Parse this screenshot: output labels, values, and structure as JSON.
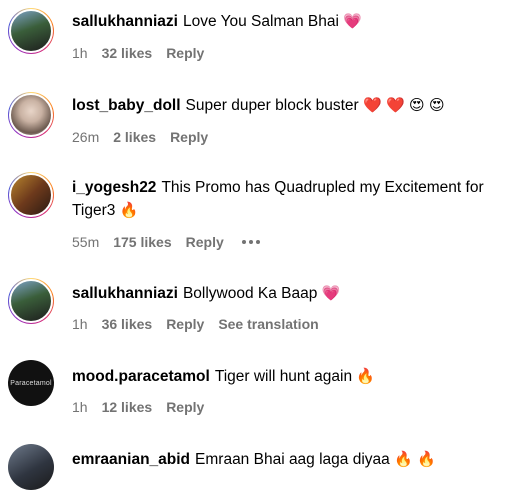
{
  "comments": [
    {
      "username": "sallukhanniazi",
      "text": "Love You Salman Bhai",
      "emojis": [
        "💗"
      ],
      "time": "1h",
      "likes": "32 likes",
      "reply": "Reply"
    },
    {
      "username": "lost_baby_doll",
      "text": "Super duper block buster",
      "emojis": [
        "❤️",
        "❤️",
        "😍",
        "😍"
      ],
      "time": "26m",
      "likes": "2 likes",
      "reply": "Reply"
    },
    {
      "username": "i_yogesh22",
      "text": "This Promo has Quadrupled my Excitement for Tiger3",
      "emojis": [
        "🔥"
      ],
      "time": "55m",
      "likes": "175 likes",
      "reply": "Reply"
    },
    {
      "username": "sallukhanniazi",
      "text": "Bollywood Ka Baap",
      "emojis": [
        "💗"
      ],
      "time": "1h",
      "likes": "36 likes",
      "reply": "Reply",
      "translate": "See translation"
    },
    {
      "username": "mood.paracetamol",
      "text": "Tiger will hunt again",
      "emojis": [
        "🔥"
      ],
      "time": "1h",
      "likes": "12 likes",
      "reply": "Reply",
      "avatar_text": "Paracetamol"
    },
    {
      "username": "emraanian_abid",
      "text": "Emraan Bhai aag laga diyaa",
      "emojis": [
        "🔥",
        "🔥"
      ],
      "time": "",
      "likes": "",
      "reply": ""
    }
  ],
  "colors": {
    "meta": "#737373",
    "heart": "#e0245e",
    "fire": "#f4900c"
  }
}
